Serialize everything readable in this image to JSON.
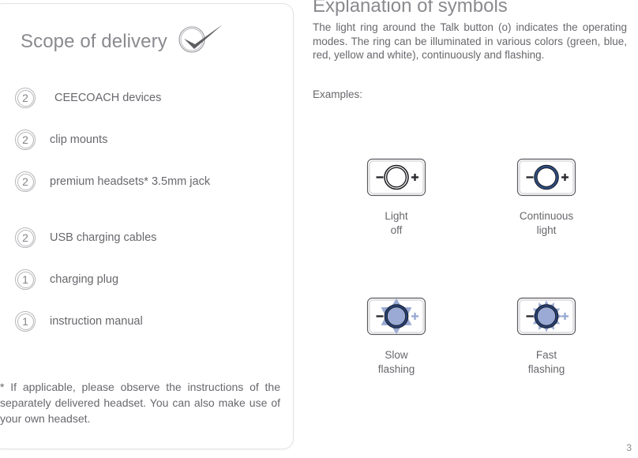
{
  "scope": {
    "title": "Scope of delivery",
    "logo_icon": "check-circle-logo",
    "items": [
      {
        "qty": "2",
        "label": "CEECOACH devices",
        "indented": true
      },
      {
        "qty": "2",
        "label": "clip mounts",
        "indented": false
      },
      {
        "qty": "2",
        "label": "premium headsets* 3.5mm jack",
        "indented": false
      },
      {
        "qty": "2",
        "label": "USB charging cables",
        "indented": false
      },
      {
        "qty": "1",
        "label": "charging plug",
        "indented": false
      },
      {
        "qty": "1",
        "label": "instruction manual",
        "indented": false
      }
    ],
    "footnote": "* If applicable, please observe the instructions of the separately delivered headset. You can also make use of your own headset."
  },
  "explanation": {
    "title": "Explanation of symbols",
    "body": "The light ring around the Talk button (o) indicates the operating modes. The ring can be illuminated in various colors (green, blue, red, yellow and white), continuously and flashing.",
    "examples_label": "Examples:",
    "symbols": [
      {
        "name": "light-off",
        "label_line1": "Light",
        "label_line2": "off",
        "ring_color": "#222226",
        "fill": "none",
        "rays": 0
      },
      {
        "name": "continuous-light",
        "label_line1": "Continuous",
        "label_line2": "light",
        "ring_color": "#2f4d82",
        "fill": "none",
        "rays": 0
      },
      {
        "name": "slow-flashing",
        "label_line1": "Slow",
        "label_line2": "flashing",
        "ring_color": "#1f3a6e",
        "fill": "#9aaad4",
        "rays": 6
      },
      {
        "name": "fast-flashing",
        "label_line1": "Fast",
        "label_line2": "flashing",
        "ring_color": "#1f3a6e",
        "fill": "#9aaad4",
        "rays": 12
      }
    ],
    "minus_icon": "minus-icon",
    "plus_icon": "plus-icon"
  },
  "page_number": "3",
  "colors": {
    "heading": "#8a8a8f",
    "text": "#68686d",
    "panel_border": "#e3e3e3",
    "ring_blue": "#2f4d82",
    "ray_blue": "#9aaad4"
  }
}
